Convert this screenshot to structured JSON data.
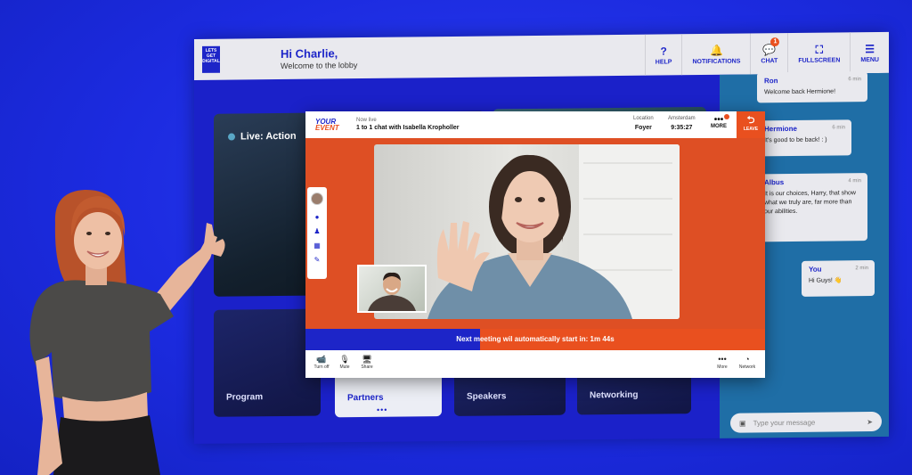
{
  "lobby": {
    "logo": "LETS GET DIGITAL",
    "greeting": "Hi Charlie,",
    "welcome": "Welcome to the lobby",
    "nav": [
      {
        "icon": "?",
        "label": "HELP"
      },
      {
        "icon": "🔔",
        "label": "NOTIFICATIONS"
      },
      {
        "icon": "💬",
        "label": "CHAT",
        "badge": "1"
      },
      {
        "icon": "⛶",
        "label": "FULLSCREEN"
      },
      {
        "icon": "☰",
        "label": "MENU"
      }
    ],
    "live_label": "Live: Action",
    "tiles": {
      "program": "Program",
      "partners": "Partners",
      "speakers": "Speakers",
      "networking": "Networking"
    },
    "carousel_dots": "•••"
  },
  "chat": {
    "messages": [
      {
        "name": "Ron",
        "time": "6 min",
        "text": "Welcome back Hermione!"
      },
      {
        "name": "Hermione",
        "time": "6 min",
        "text": "It's good to be back! : )"
      },
      {
        "name": "Albus",
        "time": "4 min",
        "text": "It is our choices, Harry, that show what we truly are, far more than our abilities."
      },
      {
        "name": "You",
        "time": "2 min",
        "text": "Hi Guys! 👋"
      }
    ],
    "input_placeholder": "Type your message",
    "send_icon": "➤"
  },
  "call": {
    "brand_line1": "YOUR",
    "brand_line2": "EVENT",
    "now_live_label": "Now live",
    "title": "1 to 1 chat with Isabella Kropholler",
    "location_label": "Location",
    "location_value": "Foyer",
    "city_label": "Amsterdam",
    "time": "9:35:27",
    "more_label": "MORE",
    "more_icon": "•••",
    "leave_label": "LEAVE",
    "countdown_text": "Next meeting wil automatically start in: 1m 44s",
    "countdown_progress": 0.38,
    "controls_left": [
      {
        "icon": "📹",
        "label": "Turn off"
      },
      {
        "icon": "🎙",
        "label": "Mute"
      },
      {
        "icon": "🖥",
        "label": "Share"
      }
    ],
    "controls_right": [
      {
        "icon": "•••",
        "label": "More"
      },
      {
        "icon": "◔",
        "label": "Network"
      }
    ]
  },
  "colors": {
    "brand_blue": "#1d25c8",
    "brand_orange": "#e9501f",
    "background_blue": "#1c2be0"
  }
}
